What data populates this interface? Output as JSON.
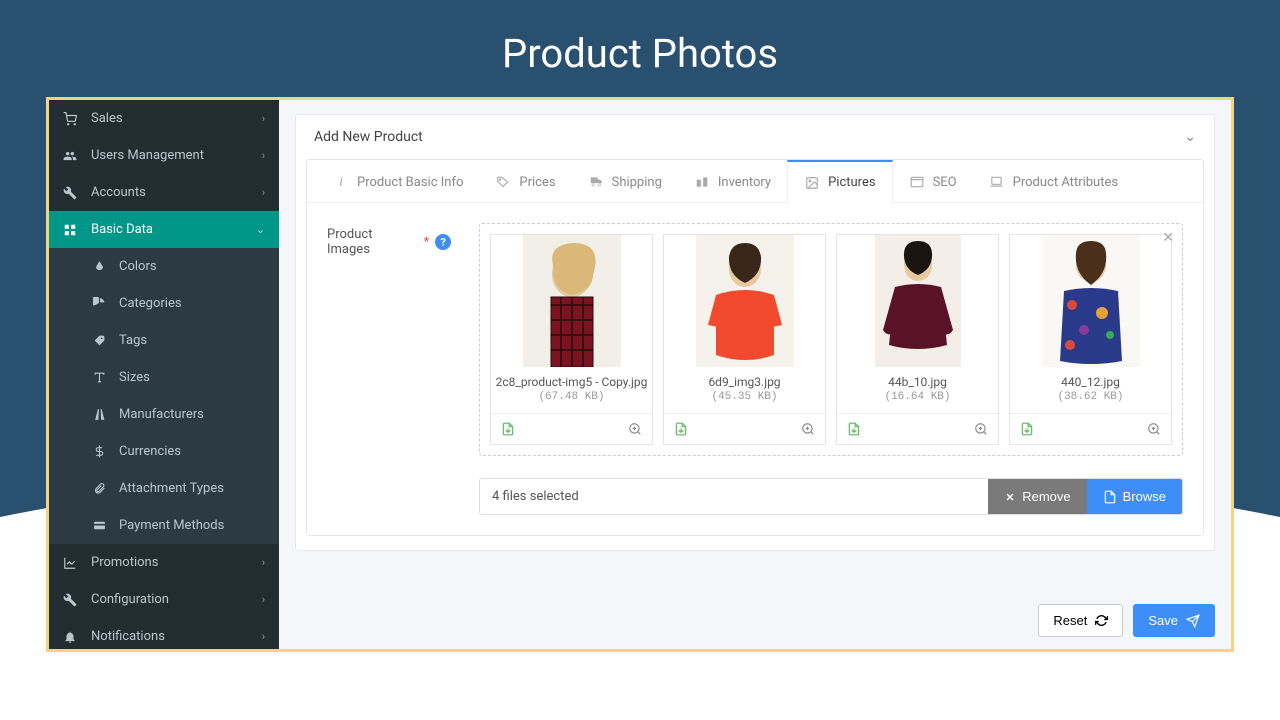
{
  "page_title": "Product Photos",
  "sidebar": {
    "items": [
      {
        "label": "Sales",
        "icon": "cart"
      },
      {
        "label": "Users Management",
        "icon": "users"
      },
      {
        "label": "Accounts",
        "icon": "wrench"
      },
      {
        "label": "Basic Data",
        "icon": "grid",
        "active": true
      },
      {
        "label": "Promotions",
        "icon": "chart"
      },
      {
        "label": "Configuration",
        "icon": "wrench"
      },
      {
        "label": "Notifications",
        "icon": "bell"
      }
    ],
    "basic_data_sub": [
      {
        "label": "Colors",
        "icon": "drop"
      },
      {
        "label": "Categories",
        "icon": "pie"
      },
      {
        "label": "Tags",
        "icon": "tag"
      },
      {
        "label": "Sizes",
        "icon": "size"
      },
      {
        "label": "Manufacturers",
        "icon": "road"
      },
      {
        "label": "Currencies",
        "icon": "dollar"
      },
      {
        "label": "Attachment Types",
        "icon": "clip"
      },
      {
        "label": "Payment Methods",
        "icon": "card"
      }
    ]
  },
  "card": {
    "title": "Add New Product",
    "tabs": [
      {
        "label": "Product Basic Info"
      },
      {
        "label": "Prices"
      },
      {
        "label": "Shipping"
      },
      {
        "label": "Inventory"
      },
      {
        "label": "Pictures",
        "active": true
      },
      {
        "label": "SEO"
      },
      {
        "label": "Product Attributes"
      }
    ],
    "form_label": "Product Images",
    "files": [
      {
        "name": "2c8_product-img5 - Copy.jpg",
        "size": "(67.48 KB)"
      },
      {
        "name": "6d9_img3.jpg",
        "size": "(45.35 KB)"
      },
      {
        "name": "44b_10.jpg",
        "size": "(16.64 KB)"
      },
      {
        "name": "440_12.jpg",
        "size": "(38.62 KB)"
      }
    ],
    "status": "4 files selected",
    "remove": "Remove",
    "browse": "Browse"
  },
  "footer": {
    "reset": "Reset",
    "save": "Save"
  }
}
